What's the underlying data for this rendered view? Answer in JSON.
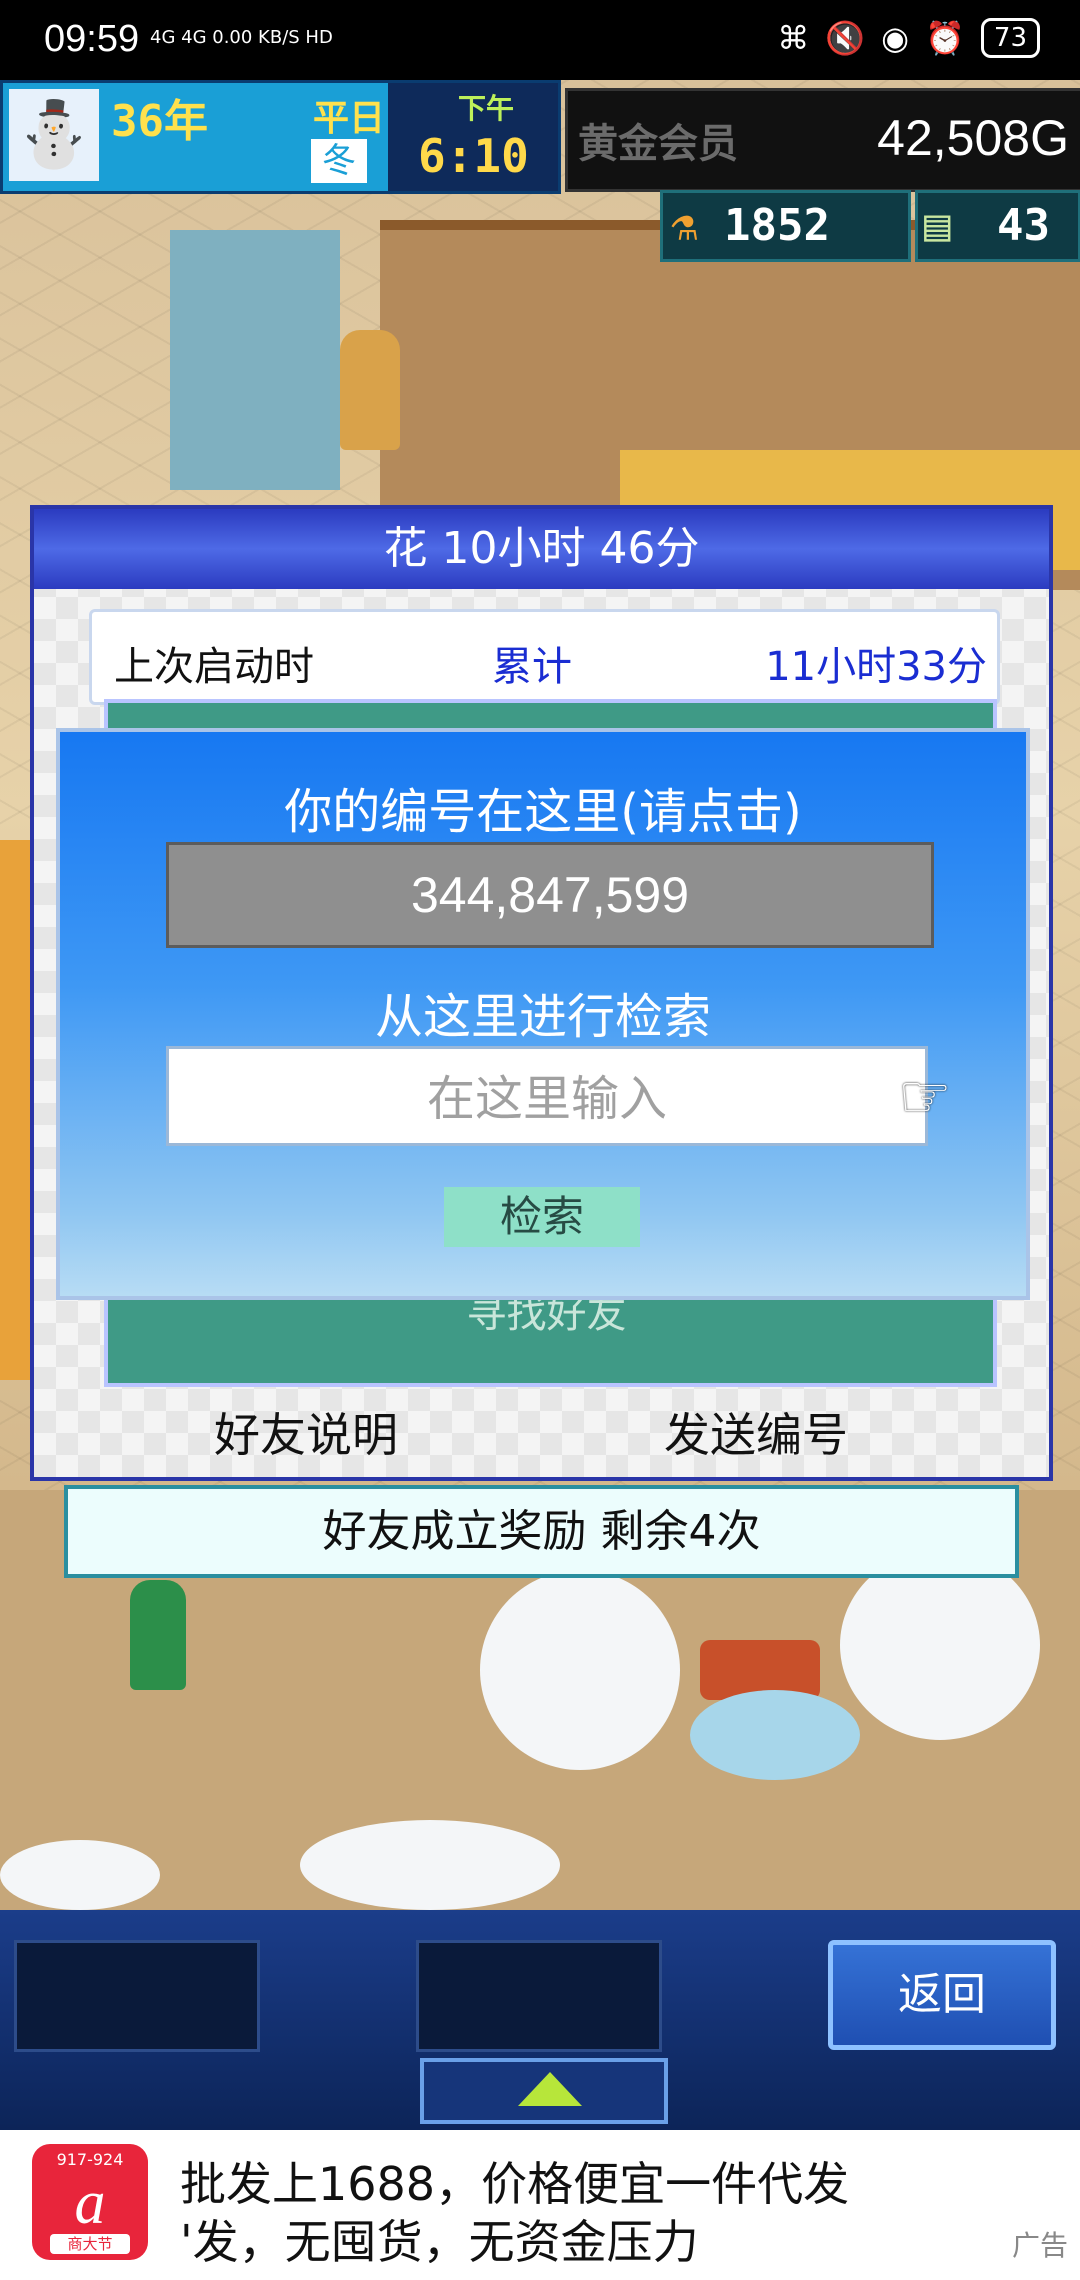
{
  "status_bar": {
    "time": "09:59",
    "network": "4G 4G 0.00 KB/S HD",
    "battery": "73"
  },
  "hud": {
    "year": "36年",
    "day_type": "平日",
    "period": "下午",
    "clock": "6:10",
    "season": "冬",
    "membership": "黄金会员",
    "money": "42,508G",
    "research_points": "1852",
    "tickets": "43"
  },
  "friend_panel": {
    "title": "花 10小时 46分",
    "last_launch_label": "上次启动时",
    "total_label": "累计",
    "total_value": "11小时33分",
    "find_friend": "寻找好友",
    "friend_info_link": "好友说明",
    "send_id_link": "发送编号"
  },
  "search_dialog": {
    "id_title": "你的编号在这里(请点击)",
    "player_id": "344,847,599",
    "search_label": "从这里进行检索",
    "search_placeholder": "在这里输入",
    "search_button": "检索"
  },
  "reward_banner": "好友成立奖励 剩余4次",
  "toolbar": {
    "back_label": "返回"
  },
  "ad": {
    "logo_number": "917-924",
    "logo_tag": "商大节",
    "line1": "批发上1688，价格便宜一件代发",
    "line2": "'发，无囤货，无资金压力",
    "ad_label": "广告"
  },
  "colors": {
    "panel_title_blue": "#2b3bc0",
    "dialog_blue": "#1778f2",
    "teal": "#3f9a86",
    "search_button": "#8ee0c8",
    "ad_red": "#e8253b"
  }
}
